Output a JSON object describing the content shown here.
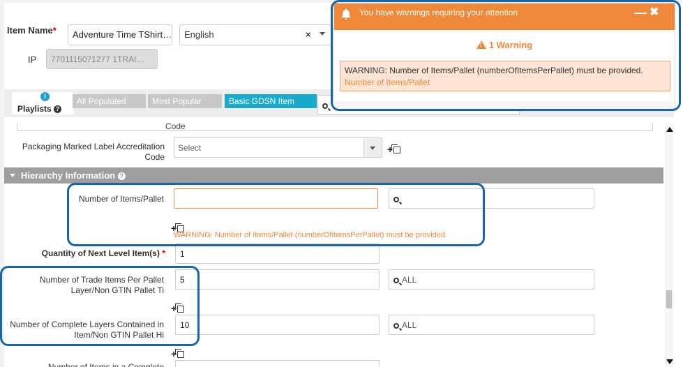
{
  "header": {
    "item_name_label": "Item Name",
    "item_name_required": "*",
    "item_name_value": "Adventure Time TShirt…",
    "language_value": "English",
    "language_clear": "×",
    "ip_label": "IP",
    "ip_value": "7701115071277 1TRAI…"
  },
  "playlists": {
    "label": "Playlists",
    "help_glyph": "?",
    "info_glyph": "i",
    "buttons": [
      "All Populated",
      "Most Popular",
      "Basic GDSN Item"
    ]
  },
  "form": {
    "cut_label": "Code",
    "packaging_label": "Packaging Marked Label Accreditation Code",
    "packaging_placeholder": "Select",
    "section_title": "Hierarchy Information",
    "items_per_pallet_label": "Number of Items/Pallet",
    "items_per_pallet_value": "",
    "items_per_pallet_warning": "WARNING: Number of Items/Pallet (numberOfItemsPerPallet) must be provided.",
    "next_level_label": "Quantity of Next Level Item(s)",
    "next_level_required": "*",
    "next_level_value": "1",
    "ti_label": "Number of Trade Items Per Pallet Layer/Non GTIN Pallet Ti",
    "ti_value": "5",
    "ti_search": "ALL",
    "hi_label": "Number of Complete Layers Contained in Item/Non GTIN Pallet Hi",
    "hi_value": "10",
    "hi_search": "ALL",
    "bottom_partial_label": "Number of Items in a Complete"
  },
  "notification": {
    "title": "You have warnings requiring your attention",
    "minimize": "—",
    "close": "✖",
    "count_label": "1 Warning",
    "message": "WARNING: Number of Items/Pallet (numberOfItemsPerPallet) must be provided.",
    "link": "Number of Items/Pallet"
  },
  "colors": {
    "accent_orange": "#f0883a",
    "highlight_blue": "#1565a8",
    "playlist_active": "#1aabcc"
  }
}
